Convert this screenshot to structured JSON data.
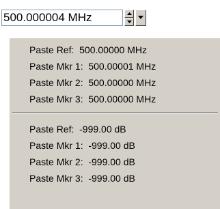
{
  "frequency_field": {
    "value": "500.000004 MHz"
  },
  "icons": {
    "spin_up": "triangle-up-icon",
    "spin_down": "triangle-down-icon",
    "dropdown": "chevron-down-icon"
  },
  "menu": {
    "frequency_items": [
      {
        "label": "Paste Ref:  500.00000 MHz"
      },
      {
        "label": "Paste Mkr 1:  500.00001 MHz"
      },
      {
        "label": "Paste Mkr 2:  500.00000 MHz"
      },
      {
        "label": "Paste Mkr 3:  500.00000 MHz"
      }
    ],
    "amplitude_items": [
      {
        "label": "Paste Ref:  -999.00 dB"
      },
      {
        "label": "Paste Mkr 1:  -999.00 dB"
      },
      {
        "label": "Paste Mkr 2:  -999.00 dB"
      },
      {
        "label": "Paste Mkr 3:  -999.00 dB"
      }
    ]
  },
  "colors": {
    "menu_background": "#d4d0c8",
    "input_border": "#7f9db9",
    "separator_dark": "#808080"
  }
}
